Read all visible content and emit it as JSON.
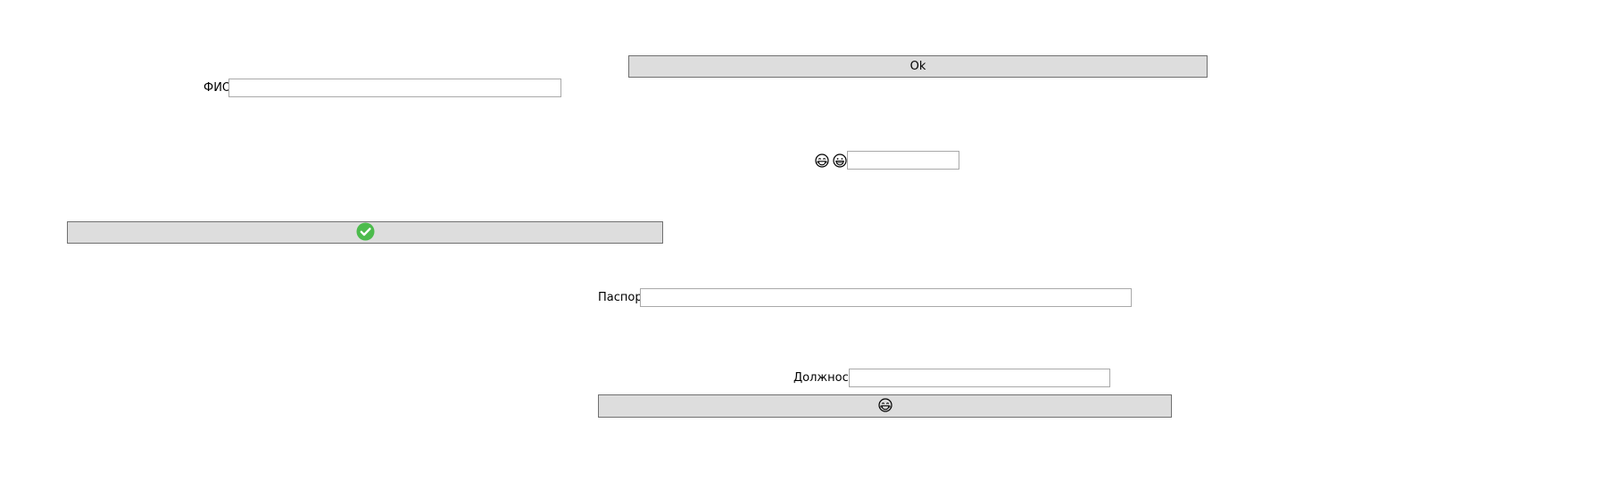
{
  "ok_button": {
    "label": "Ok"
  },
  "fio_field": {
    "label": "ФИО",
    "value": ""
  },
  "emoji_field": {
    "value": ""
  },
  "passport_field": {
    "label": "Паспорт",
    "value": ""
  },
  "position_field": {
    "label": "Должность",
    "value": ""
  },
  "icons": {
    "confirm_button": "green-checkmark-icon",
    "emoji_button": "laughing-face-icon",
    "emoji_label_1": "laughing-face-icon",
    "emoji_label_2": "grinning-face-icon"
  },
  "colors": {
    "button_bg": "#dddddd",
    "button_border": "#707070",
    "input_border": "#a9a9a9",
    "check_green": "#4cbb4c"
  }
}
